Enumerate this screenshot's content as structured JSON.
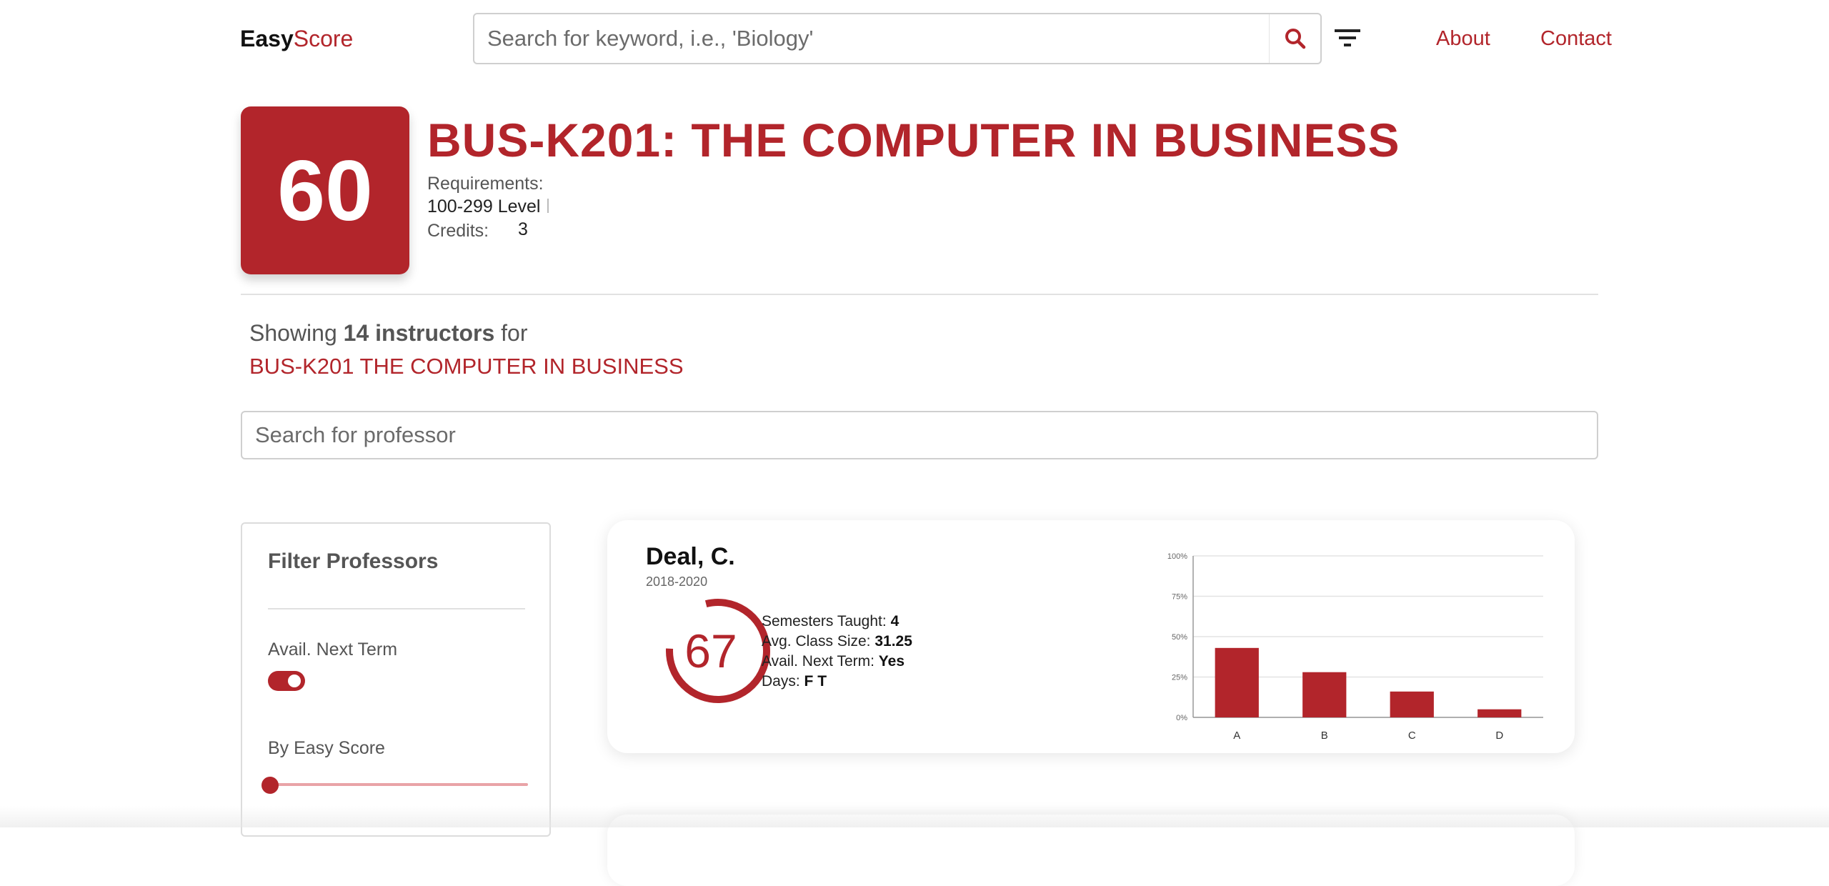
{
  "header": {
    "logo_bold": "Easy",
    "logo_rest": "Score",
    "search_placeholder": "Search for keyword, i.e., 'Biology'",
    "nav": [
      "About",
      "Contact"
    ]
  },
  "course": {
    "score": "60",
    "title": "BUS-K201: THE COMPUTER IN BUSINESS",
    "requirements_label": "Requirements:",
    "level": "100-299 Level",
    "credits_label": "Credits:",
    "credits": "3"
  },
  "showing": {
    "prefix": "Showing",
    "count": "14 instructors",
    "suffix": "for",
    "course": "BUS-K201 THE COMPUTER IN BUSINESS"
  },
  "professor_search": {
    "placeholder": "Search for professor"
  },
  "filters": {
    "title": "Filter Professors",
    "avail_label": "Avail. Next Term",
    "avail_on": true,
    "score_label": "By Easy Score",
    "score_value": 0
  },
  "professors": [
    {
      "name": "Deal, C.",
      "years": "2018-2020",
      "score": "67",
      "score_fraction": 0.67,
      "semesters_label": "Semesters Taught:",
      "semesters": "4",
      "class_size_label": "Avg. Class Size:",
      "class_size": "31.25",
      "avail_label": "Avail. Next Term:",
      "avail": "Yes",
      "days_label": "Days:",
      "days": "F T"
    }
  ],
  "colors": {
    "accent": "#b2252b"
  },
  "chart_data": {
    "type": "bar",
    "categories": [
      "A",
      "B",
      "C",
      "D"
    ],
    "values": [
      43,
      28,
      16,
      5
    ],
    "y_ticks": [
      "0%",
      "25%",
      "50%",
      "75%",
      "100%"
    ],
    "ylim": [
      0,
      100
    ],
    "grid": true
  }
}
